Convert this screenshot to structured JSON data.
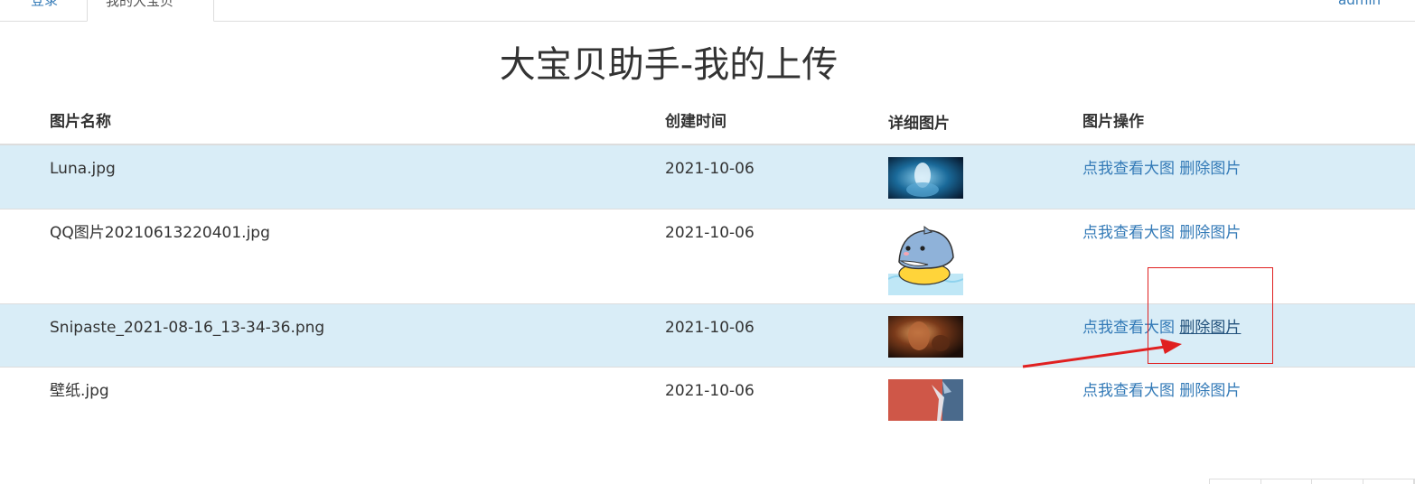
{
  "nav": {
    "tabs": [
      {
        "label": "登录"
      },
      {
        "label": "我的大宝贝"
      }
    ],
    "user": "admin"
  },
  "page": {
    "title": "大宝贝助手-我的上传"
  },
  "table": {
    "headers": [
      "图片名称",
      "创建时间",
      "详细图片",
      "图片操作"
    ],
    "rows": [
      {
        "name": "Luna.jpg",
        "date": "2021-10-06",
        "thumb": "blue-underwater-figure",
        "view": "点我查看大图",
        "delete": "删除图片"
      },
      {
        "name": "QQ图片20210613220401.jpg",
        "date": "2021-10-06",
        "thumb": "cartoon-shark-duck-float",
        "view": "点我查看大图",
        "delete": "删除图片"
      },
      {
        "name": "Snipaste_2021-08-16_13-34-36.png",
        "date": "2021-10-06",
        "thumb": "dark-orange-armored-figure",
        "view": "点我查看大图",
        "delete": "删除图片"
      },
      {
        "name": "壁纸.jpg",
        "date": "2021-10-06",
        "thumb": "red-blue-split-wallpaper",
        "view": "点我查看大图",
        "delete": "删除图片"
      }
    ]
  },
  "colors": {
    "link": "#337ab7",
    "row_highlight": "#d9edf7",
    "annotation": "#e02020"
  }
}
